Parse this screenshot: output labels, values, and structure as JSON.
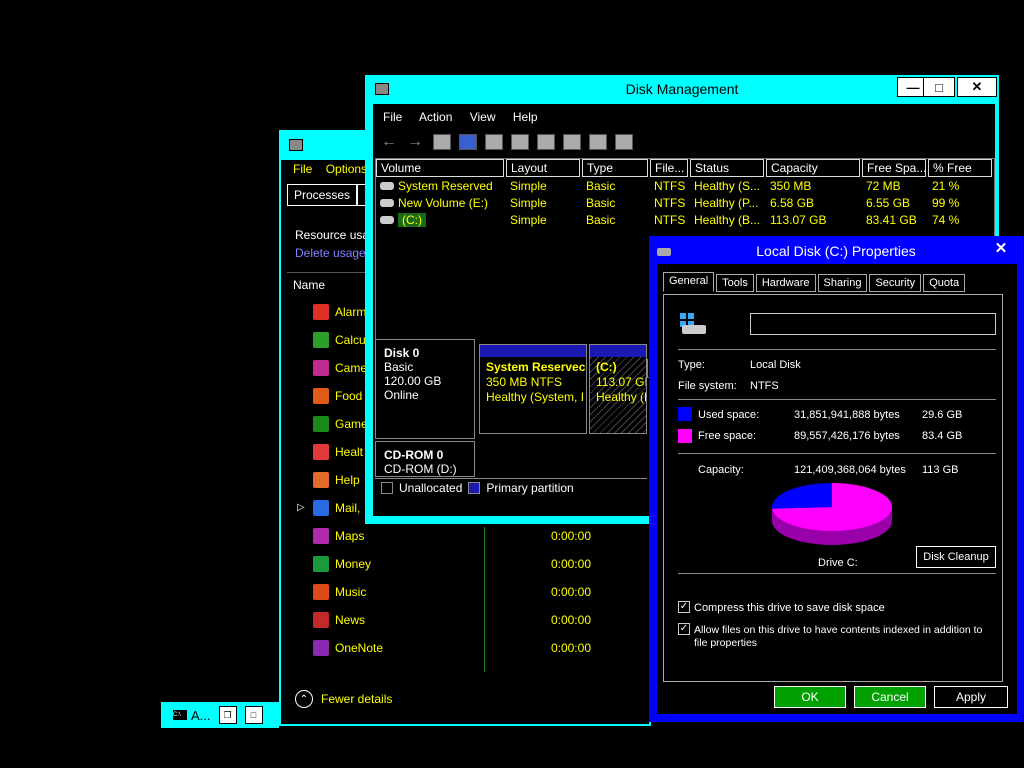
{
  "task_manager": {
    "menu": [
      "File",
      "Options"
    ],
    "tabs": [
      "Processes",
      "P"
    ],
    "resource_usage": "Resource usa",
    "delete_usage": "Delete usage",
    "column_name": "Name",
    "rows": [
      {
        "name": "Alarm",
        "cpu": "",
        "color": "#e0302a"
      },
      {
        "name": "Calcu",
        "cpu": "",
        "color": "#2aa02a"
      },
      {
        "name": "Came",
        "cpu": "",
        "color": "#c02a90"
      },
      {
        "name": "Food",
        "cpu": "",
        "color": "#e05a1a"
      },
      {
        "name": "Game",
        "cpu": "",
        "color": "#1a8a1a"
      },
      {
        "name": "Healt",
        "cpu": "",
        "color": "#e03a3a"
      },
      {
        "name": "Help",
        "cpu": "",
        "color": "#e06a2a"
      },
      {
        "name": "Mail,",
        "cpu": "",
        "color": "#2a6ae0"
      },
      {
        "name": "Maps",
        "cpu": "0:00:00",
        "color": "#b02ab0"
      },
      {
        "name": "Money",
        "cpu": "0:00:00",
        "color": "#1a9a3a"
      },
      {
        "name": "Music",
        "cpu": "0:00:00",
        "color": "#e04a1a"
      },
      {
        "name": "News",
        "cpu": "0:00:00",
        "color": "#c02a2a"
      },
      {
        "name": "OneNote",
        "cpu": "0:00:00",
        "color": "#8a2ab0"
      }
    ],
    "fewer_details": "Fewer details"
  },
  "taskbar_mini": {
    "label": "A..."
  },
  "disk_management": {
    "title": "Disk Management",
    "menu": [
      "File",
      "Action",
      "View",
      "Help"
    ],
    "columns": [
      "Volume",
      "Layout",
      "Type",
      "File...",
      "Status",
      "Capacity",
      "Free Spa...",
      "% Free"
    ],
    "volumes": [
      {
        "volume": "System Reserved",
        "layout": "Simple",
        "type": "Basic",
        "fs": "NTFS",
        "status": "Healthy (S...",
        "capacity": "350 MB",
        "free": "72 MB",
        "pct": "21 %"
      },
      {
        "volume": "New Volume (E:)",
        "layout": "Simple",
        "type": "Basic",
        "fs": "NTFS",
        "status": "Healthy (P...",
        "capacity": "6.58 GB",
        "free": "6.55 GB",
        "pct": "99 %"
      },
      {
        "volume": "(C:)",
        "layout": "Simple",
        "type": "Basic",
        "fs": "NTFS",
        "status": "Healthy (B...",
        "capacity": "113.07 GB",
        "free": "83.41 GB",
        "pct": "74 %"
      }
    ],
    "disk0": {
      "name": "Disk 0",
      "type": "Basic",
      "size": "120.00 GB",
      "state": "Online"
    },
    "partitions": [
      {
        "title": "System Reservec",
        "size": "350 MB NTFS",
        "status": "Healthy (System, I"
      },
      {
        "title": "(C:)",
        "size": "113.07 GB",
        "status": "Healthy (E"
      }
    ],
    "cdrom": {
      "name": "CD-ROM 0",
      "drive": "CD-ROM (D:)"
    },
    "legend": {
      "unallocated": "Unallocated",
      "primary": "Primary partition"
    }
  },
  "properties": {
    "title": "Local Disk (C:) Properties",
    "tabs": [
      "General",
      "Tools",
      "Hardware",
      "Sharing",
      "Security",
      "Quota"
    ],
    "label_value": "",
    "type_label": "Type:",
    "type_value": "Local Disk",
    "fs_label": "File system:",
    "fs_value": "NTFS",
    "used_label": "Used space:",
    "used_bytes": "31,851,941,888 bytes",
    "used_gb": "29.6 GB",
    "free_label": "Free space:",
    "free_bytes": "89,557,426,176 bytes",
    "free_gb": "83.4 GB",
    "cap_label": "Capacity:",
    "cap_bytes": "121,409,368,064 bytes",
    "cap_gb": "113 GB",
    "drive_label": "Drive C:",
    "disk_cleanup": "Disk Cleanup",
    "compress": "Compress this drive to save disk space",
    "index1": "Allow files on this drive to have contents indexed in addition to",
    "index2": "file properties",
    "ok": "OK",
    "cancel": "Cancel",
    "apply": "Apply",
    "colors": {
      "used": "#0000ff",
      "free": "#ff00ff"
    },
    "used_fraction": 0.262
  }
}
